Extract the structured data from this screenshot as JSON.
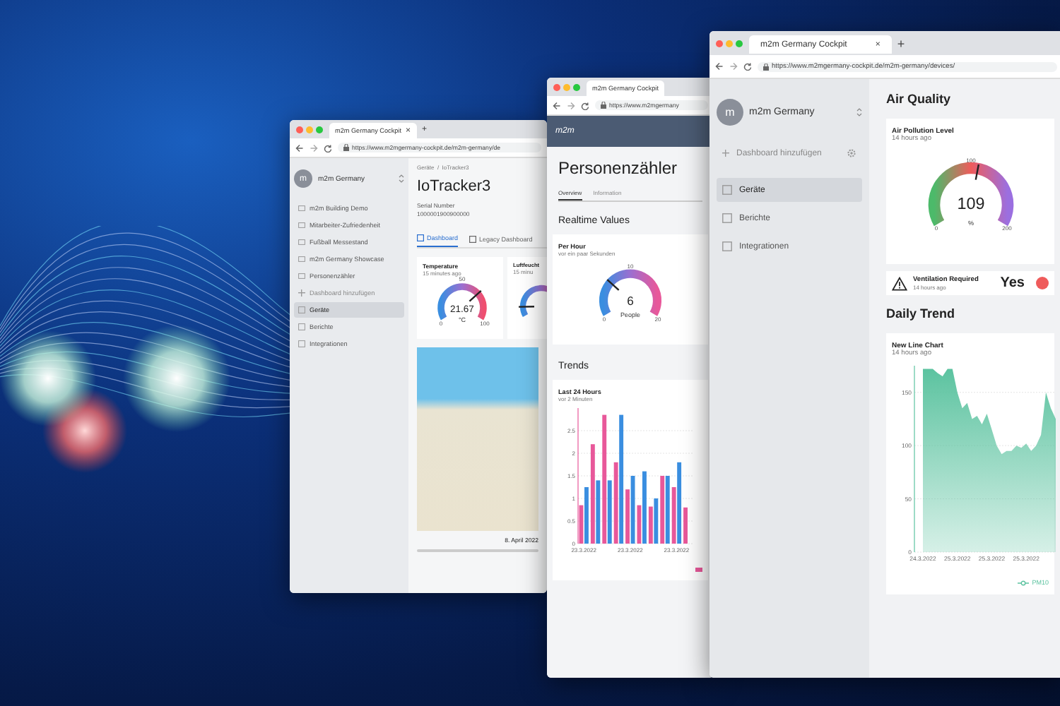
{
  "back_window": {
    "tab": {
      "title": "m2m Germany Cockpit",
      "close": "×"
    },
    "new_tab": "+",
    "url": "https://www.m2mgermany-cockpit.de/m2m-germany/de",
    "sidebar": {
      "avatar": "m",
      "account": "m2m Germany",
      "dashboards": [
        "m2m Building Demo",
        "Mitarbeiter-Zufriedenheit",
        "Fußball Messestand",
        "m2m Germany Showcase",
        "Personenzähler"
      ],
      "add_dashboard": "Dashboard hinzufügen",
      "items": [
        {
          "label": "Geräte",
          "selected": true
        },
        {
          "label": "Berichte",
          "selected": false
        },
        {
          "label": "Integrationen",
          "selected": false
        }
      ]
    },
    "breadcrumb": "Geräte  /  IoTracker3",
    "title": "IoTracker3",
    "serial_label": "Serial Number",
    "serial": "1000001900900000",
    "tabs": [
      {
        "label": "Dashboard",
        "selected": true
      },
      {
        "label": "Legacy Dashboard",
        "selected": false
      }
    ],
    "cards": [
      {
        "title": "Temperature",
        "time": "15 minutes ago",
        "value": "21.67",
        "unit": "°C",
        "min": "0",
        "mid": "50",
        "max": "100",
        "level": 0.7
      },
      {
        "title": "Luftfeucht",
        "time": "15 minu",
        "level": 0.12
      }
    ],
    "map_date": "8. April 2022"
  },
  "middle_window": {
    "tab": {
      "title": "m2m Germany Cockpit"
    },
    "url": "https://www.m2mgermany",
    "logo": "m2m",
    "title": "Personenzähler",
    "tabs": [
      {
        "label": "Overview",
        "selected": true
      },
      {
        "label": "Information",
        "selected": false
      }
    ],
    "realtime_heading": "Realtime Values",
    "gauge_card": {
      "title": "Per Hour",
      "time": "vor ein paar Sekunden",
      "value": "6",
      "unit": "People",
      "min": "0",
      "mid": "10",
      "max": "20",
      "level": 0.3
    },
    "trends_heading": "Trends",
    "chart_card": {
      "title": "Last 24 Hours",
      "time": "vor 2 Minuten",
      "chart_data": {
        "type": "bar",
        "grid": true,
        "categories": [
          "23.3.2022",
          null,
          null,
          null,
          "23.3.2022",
          null,
          null,
          null,
          "23.3.2022",
          null
        ],
        "ylim": [
          0,
          3
        ],
        "yticks": [
          0,
          0.5,
          1,
          1.5,
          2,
          2.5
        ],
        "series": [
          {
            "color": "#e8589a",
            "values": [
              0.85,
              2.2,
              2.85,
              1.8,
              1.2,
              0.85,
              0.82,
              1.5,
              1.25,
              0.8
            ]
          },
          {
            "color": "#3a8ee0",
            "values": [
              1.25,
              1.4,
              1.4,
              2.85,
              1.5,
              1.6,
              1.0,
              1.5,
              1.8,
              null
            ]
          }
        ]
      }
    }
  },
  "front_window": {
    "tab": {
      "title": "m2m Germany Cockpit",
      "close": "×"
    },
    "new_tab": "+",
    "url": "https://www.m2mgermany-cockpit.de/m2m-germany/devices/",
    "sidebar": {
      "avatar": "m",
      "account": "m2m Germany",
      "add_dashboard": "Dashboard hinzufügen",
      "items": [
        {
          "label": "Geräte",
          "selected": true
        },
        {
          "label": "Berichte",
          "selected": false
        },
        {
          "label": "Integrationen",
          "selected": false
        }
      ]
    },
    "heading": "Air Quality",
    "gauge_card": {
      "title": "Air Pollution Level",
      "time": "14 hours ago",
      "value": "109",
      "unit": "%",
      "min": "0",
      "mid": "100",
      "max": "200",
      "level": 0.545
    },
    "alert": {
      "title": "Ventilation Required",
      "time": "14 hours ago",
      "value": "Yes",
      "color": "#ef5b5b"
    },
    "trend_heading": "Daily Trend",
    "chart_card": {
      "title": "New Line Chart",
      "time": "14 hours ago",
      "chart_data": {
        "type": "area",
        "grid": true,
        "ylim": [
          0,
          175
        ],
        "yticks": [
          0,
          50,
          100,
          150
        ],
        "categories": [
          "24.3.2022",
          null,
          null,
          null,
          null,
          null,
          null,
          "25.3.2022",
          null,
          null,
          null,
          null,
          null,
          null,
          "25.3.2022",
          null,
          null,
          null,
          null,
          null,
          null,
          "25.3.2022",
          null,
          null,
          null,
          null,
          null,
          null
        ],
        "series": [
          {
            "name": "PM10",
            "color": "#5cc3a0",
            "values": [
              172,
              172,
              172,
              168,
              165,
              172,
              172,
              150,
              135,
              140,
              125,
              128,
              120,
              130,
              115,
              100,
              92,
              95,
              95,
              100,
              98,
              102,
              95,
              100,
              110,
              150,
              135,
              125
            ]
          }
        ]
      }
    }
  }
}
